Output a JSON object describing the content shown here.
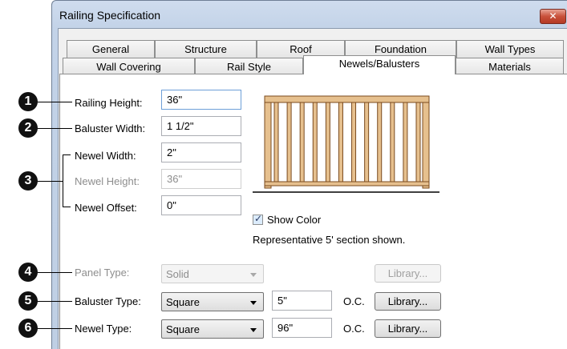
{
  "dialog": {
    "title": "Railing Specification",
    "close_label": "✕"
  },
  "tabs": {
    "row1": [
      "General",
      "Structure",
      "Roof",
      "Foundation",
      "Wall Types"
    ],
    "row2": [
      "Wall Covering",
      "Rail Style",
      "Newels/Balusters",
      "Materials"
    ],
    "active": "Newels/Balusters"
  },
  "fields": {
    "railing_height": {
      "label": "Railing Height:",
      "value": "36\""
    },
    "baluster_width": {
      "label": "Baluster Width:",
      "value": "1 1/2\""
    },
    "newel_width": {
      "label": "Newel Width:",
      "value": "2\""
    },
    "newel_height": {
      "label": "Newel Height:",
      "value": "36\""
    },
    "newel_offset": {
      "label": "Newel Offset:",
      "value": "0\""
    }
  },
  "preview": {
    "show_color_label": "Show Color",
    "show_color_checked": true,
    "caption": "Representative 5' section shown.",
    "rail_color": "#e6c08e",
    "line_color": "#7a4a1e"
  },
  "types": {
    "panel": {
      "label": "Panel Type:",
      "value": "Solid",
      "library": "Library...",
      "enabled": false
    },
    "baluster": {
      "label": "Baluster Type:",
      "value": "Square",
      "spacing": "5\"",
      "oc": "O.C.",
      "library": "Library..."
    },
    "newel": {
      "label": "Newel Type:",
      "value": "Square",
      "spacing": "96\"",
      "oc": "O.C.",
      "library": "Library..."
    }
  },
  "callouts": [
    "1",
    "2",
    "3",
    "4",
    "5",
    "6"
  ]
}
